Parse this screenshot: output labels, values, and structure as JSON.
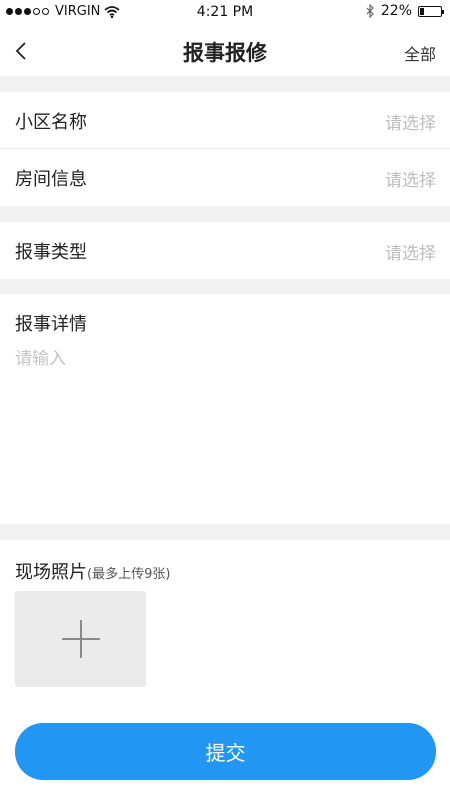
{
  "status_bar": {
    "carrier": "VIRGIN",
    "time": "4:21 PM",
    "battery_text": "22%",
    "battery_level": 0.22
  },
  "nav": {
    "title": "报事报修",
    "right_label": "全部"
  },
  "form": {
    "community_label": "小区名称",
    "community_value": "请选择",
    "room_label": "房间信息",
    "room_value": "请选择",
    "type_label": "报事类型",
    "type_value": "请选择",
    "detail_label": "报事详情",
    "detail_placeholder": "请输入",
    "photos_label": "现场照片",
    "photos_hint": "(最多上传9张)"
  },
  "submit_label": "提交",
  "colors": {
    "accent": "#2196f3",
    "placeholder": "#bdbdbd",
    "background": "#f2f2f2"
  }
}
